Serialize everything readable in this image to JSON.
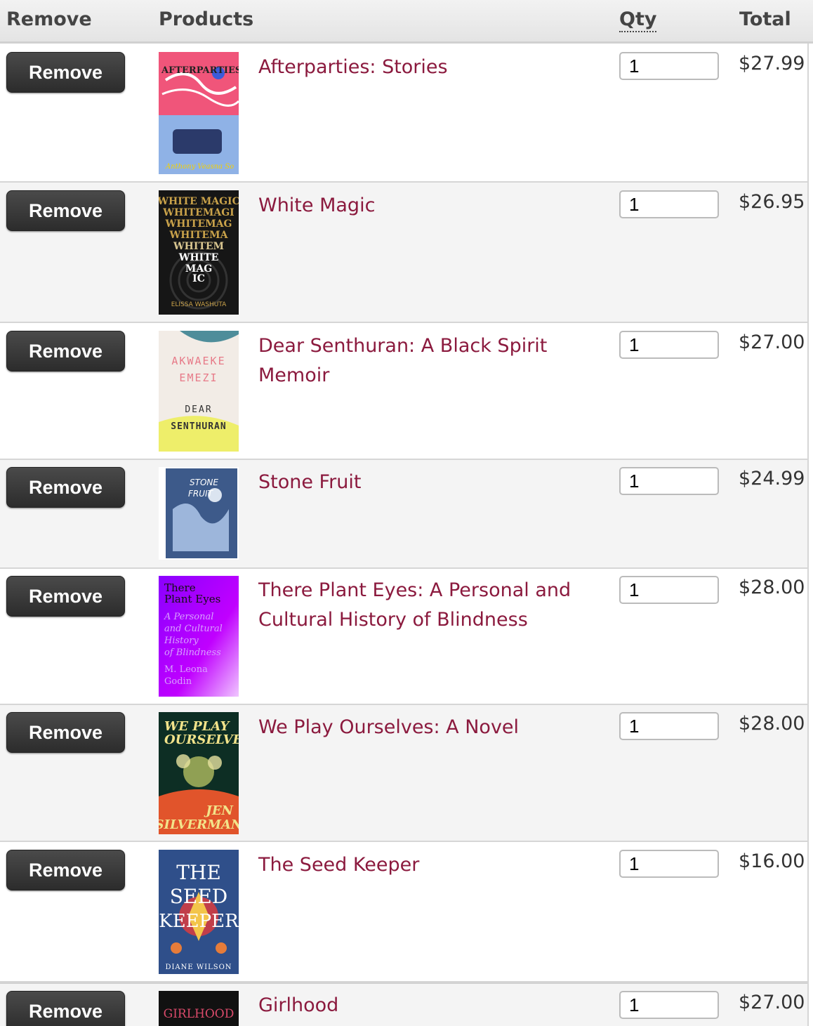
{
  "header": {
    "remove_label": "Remove",
    "products_label": "Products",
    "qty_label": "Qty",
    "total_label": "Total"
  },
  "colors": {
    "title_link": "#8b1a3e",
    "button_bg": "#333333",
    "row_alt_bg": "#f4f4f4"
  },
  "items": [
    {
      "remove_label": "Remove",
      "title": "Afterparties: Stories",
      "qty": "1",
      "total": "$27.99",
      "cover_text": [
        "AFTERPARTIES",
        "Anthony Veasna So"
      ]
    },
    {
      "remove_label": "Remove",
      "title": "White Magic",
      "qty": "1",
      "total": "$26.95",
      "cover_text": [
        "WHITE MAGIC",
        "ELISSA WASHUTA"
      ]
    },
    {
      "remove_label": "Remove",
      "title": "Dear Senthuran: A Black Spirit Memoir",
      "qty": "1",
      "total": "$27.00",
      "cover_text": [
        "AKWAEKE",
        "EMEZI",
        "DEAR",
        "SENTHURAN"
      ]
    },
    {
      "remove_label": "Remove",
      "title": "Stone Fruit",
      "qty": "1",
      "total": "$24.99",
      "cover_text": [
        "STONE",
        "FRUIT"
      ]
    },
    {
      "remove_label": "Remove",
      "title": "There Plant Eyes: A Personal and Cultural History of Blindness",
      "qty": "1",
      "total": "$28.00",
      "cover_text": [
        "There",
        "Plant Eyes",
        "A Personal",
        "and Cultural",
        "History",
        "of Blindness",
        "M. Leona",
        "Godin"
      ]
    },
    {
      "remove_label": "Remove",
      "title": "We Play Ourselves: A Novel",
      "qty": "1",
      "total": "$28.00",
      "cover_text": [
        "WE PLAY",
        "OURSELVES",
        "JEN",
        "SILVERMAN"
      ]
    },
    {
      "remove_label": "Remove",
      "title": "The Seed Keeper",
      "qty": "1",
      "total": "$16.00",
      "cover_text": [
        "THE",
        "SEED",
        "KEEPER",
        "DIANE WILSON"
      ]
    },
    {
      "remove_label": "Remove",
      "title": "Girlhood",
      "qty": "1",
      "total": "$27.00",
      "cover_text": [
        "GIRLHOOD"
      ]
    }
  ]
}
